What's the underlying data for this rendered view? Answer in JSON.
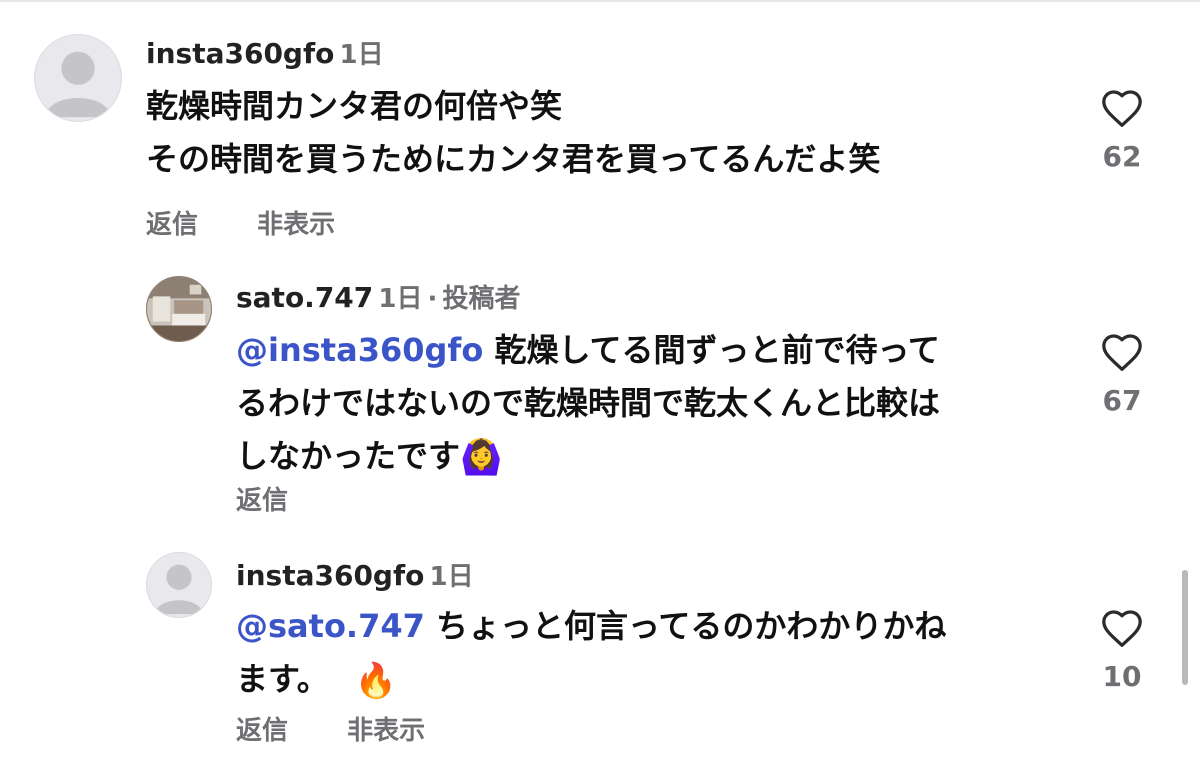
{
  "comments": [
    {
      "username": "insta360gfo",
      "time": "1日",
      "lines": [
        "乾燥時間カンタ君の何倍や笑",
        "その時間を買うためにカンタ君を買ってるんだよ笑"
      ],
      "reply_label": "返信",
      "hide_label": "非表示",
      "likes": "62",
      "avatar": "default-avatar"
    },
    {
      "username": "sato.747",
      "time": "1日",
      "separator": "·",
      "author_badge": "投稿者",
      "mention": "@insta360gfo",
      "line1_rest": " 乾燥してる間ずっと前で待って",
      "line2": "るわけではないので乾燥時間で乾太くんと比較は",
      "line3": "しなかったです",
      "emoji": "🙆‍♀️",
      "reply_label": "返信",
      "likes": "67",
      "avatar": "photo-avatar"
    },
    {
      "username": "insta360gfo",
      "time": "1日",
      "mention": "@sato.747",
      "line1_rest": " ちょっと何言ってるのかわかりかね",
      "line2": "ます。",
      "emoji": "🔥",
      "reply_label": "返信",
      "hide_label": "非表示",
      "likes": "10",
      "avatar": "default-avatar"
    }
  ],
  "icons": {
    "like": "heart-outline-icon"
  },
  "colors": {
    "mention": "#3b55c9",
    "secondary_text": "#6f6f73"
  }
}
